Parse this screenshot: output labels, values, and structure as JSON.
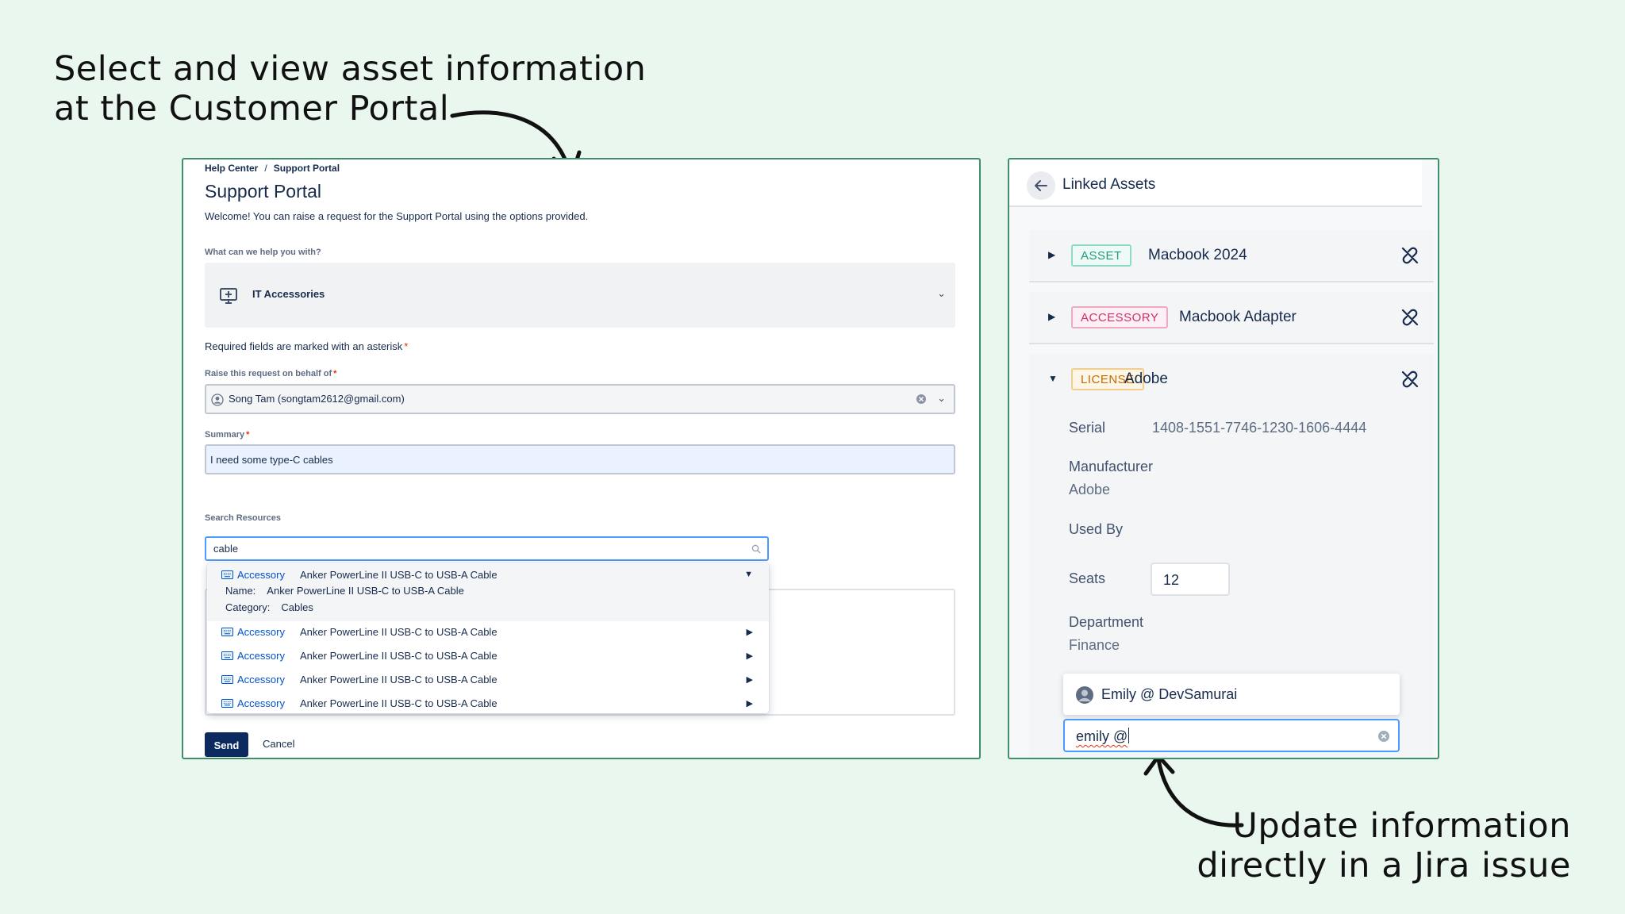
{
  "captions": {
    "top_line1": "Select and view asset information",
    "top_line2": "at the Customer Portal",
    "bottom_line1": "Update information",
    "bottom_line2": "directly in a Jira issue"
  },
  "portal": {
    "breadcrumb": {
      "home": "Help Center",
      "separator": "/",
      "current": "Support Portal"
    },
    "title": "Support Portal",
    "welcome": "Welcome! You can raise a request for the Support Portal using the options provided.",
    "help_label": "What can we help you with?",
    "request_type": {
      "label": "IT Accessories",
      "icon": "monitor-plus-icon"
    },
    "required_note": "Required fields are marked with an asterisk",
    "behalf": {
      "label": "Raise this request on behalf of",
      "value": "Song Tam (songtam2612@gmail.com)"
    },
    "summary": {
      "label": "Summary",
      "value": "I need some type-C cables"
    },
    "search": {
      "label": "Search Resources",
      "value": "cable",
      "expanded": {
        "type": "Accessory",
        "name": "Anker PowerLine II USB-C to USB-A Cable",
        "details": [
          {
            "key": "Name:",
            "value": "Anker PowerLine II USB-C to USB-A Cable"
          },
          {
            "key": "Category:",
            "value": "Cables"
          }
        ]
      },
      "results": [
        {
          "type": "Accessory",
          "name": "Anker PowerLine II USB-C to USB-A Cable"
        },
        {
          "type": "Accessory",
          "name": "Anker PowerLine II USB-C to USB-A Cable"
        },
        {
          "type": "Accessory",
          "name": "Anker PowerLine II USB-C to USB-A Cable"
        },
        {
          "type": "Accessory",
          "name": "Anker PowerLine II USB-C to USB-A Cable"
        }
      ]
    },
    "buttons": {
      "send": "Send",
      "cancel": "Cancel"
    }
  },
  "linked_assets": {
    "title": "Linked Assets",
    "items": [
      {
        "badge": "ASSET",
        "name": "Macbook 2024",
        "expanded": false
      },
      {
        "badge": "ACCESSORY",
        "name": "Macbook Adapter",
        "expanded": false
      },
      {
        "badge": "LICENSE",
        "name": "Adobe",
        "expanded": true
      }
    ],
    "license_details": {
      "serial_label": "Serial",
      "serial_value": "1408-1551-7746-1230-1606-4444",
      "manufacturer_label": "Manufacturer",
      "manufacturer_value": "Adobe",
      "used_by_label": "Used By",
      "seats_label": "Seats",
      "seats_value": "12",
      "department_label": "Department",
      "department_value": "Finance"
    },
    "user_picker": {
      "suggestion": "Emily @ DevSamurai",
      "input_value": "emily @"
    }
  },
  "colors": {
    "background": "#e9f7ef",
    "panel_border": "#3f8f6a",
    "primary_button": "#0c2a60",
    "link_blue": "#0052cc",
    "focus_blue": "#4c9aff"
  }
}
